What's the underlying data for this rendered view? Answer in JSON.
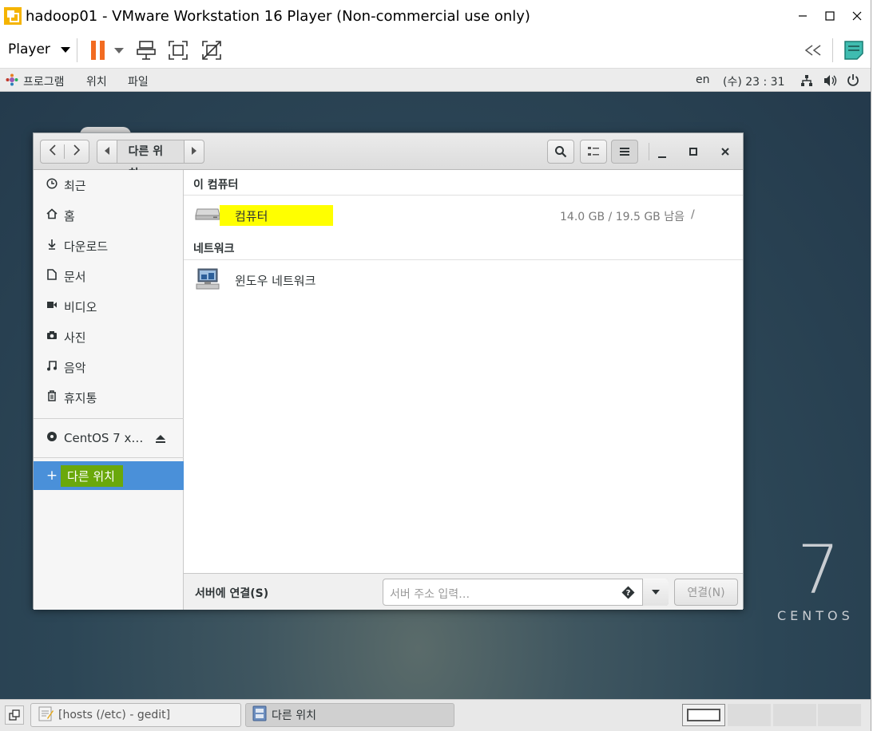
{
  "vm": {
    "title": "hadoop01 - VMware Workstation 16 Player (Non-commercial use only)",
    "player_label": "Player"
  },
  "topbar": {
    "menu_programs": "프로그램",
    "menu_places": "위치",
    "menu_files": "파일",
    "lang": "en",
    "clock": "(수) 23 : 31"
  },
  "desktop": {
    "logo_number": "7",
    "logo_text": "CENTOS"
  },
  "nautilus": {
    "path_label": "다른 위치",
    "sidebar": {
      "recent": "최근",
      "home": "홈",
      "downloads": "다운로드",
      "documents": "문서",
      "videos": "비디오",
      "pictures": "사진",
      "music": "음악",
      "trash": "휴지통",
      "device": "CentOS 7 x…",
      "other_locations": "다른 위치"
    },
    "main": {
      "section_computer": "이 컴퓨터",
      "computer_label": "컴퓨터",
      "computer_usage": "14.0 GB / 19.5 GB 남음",
      "computer_mount": "/",
      "section_network": "네트워크",
      "windows_network": "윈도우 네트워크"
    },
    "connect": {
      "label": "서버에 연결(S)",
      "placeholder": "서버 주소 입력…",
      "button": "연결(N)"
    }
  },
  "taskbar": {
    "task_gedit": "[hosts (/etc) - gedit]",
    "task_files": "다른 위치"
  },
  "colors": {
    "selection_blue": "#4a90d9",
    "highlight_yellow": "#ffff00",
    "highlight_green": "#6aa80b",
    "pause_orange": "#f26b21"
  }
}
